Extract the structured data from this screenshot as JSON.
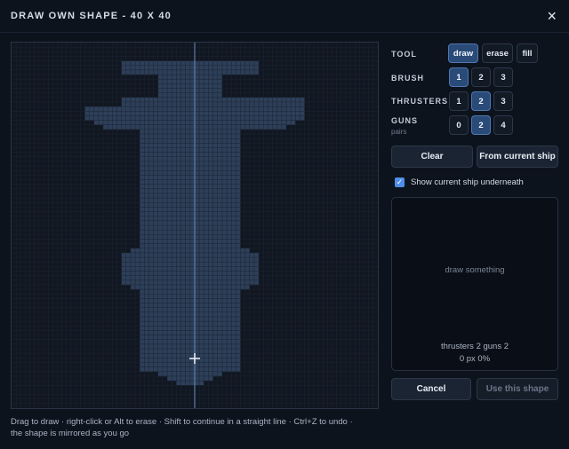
{
  "header": {
    "title": "DRAW OWN SHAPE - 40 X 40",
    "close_label": "×"
  },
  "canvas": {
    "grid_size": 40,
    "background": "#0d1119",
    "empty_cell": "#111721",
    "grid_line": "#1c2431",
    "filled_cell": "#2d3f59",
    "filled_grid_line": "#34486a",
    "axis_color": "#5d7eaa",
    "rows_filled_extents": [
      [
        0,
        0
      ],
      [
        0,
        0
      ],
      [
        0,
        0
      ],
      [
        0,
        0
      ],
      [
        12,
        27
      ],
      [
        12,
        27
      ],
      [
        12,
        27
      ],
      [
        16,
        23
      ],
      [
        16,
        23
      ],
      [
        16,
        23
      ],
      [
        16,
        23
      ],
      [
        16,
        23
      ],
      [
        12,
        32
      ],
      [
        12,
        32
      ],
      [
        8,
        32
      ],
      [
        8,
        32
      ],
      [
        8,
        32
      ],
      [
        9,
        31
      ],
      [
        10,
        30
      ],
      [
        14,
        25
      ],
      [
        14,
        25
      ],
      [
        14,
        25
      ],
      [
        14,
        25
      ],
      [
        14,
        25
      ],
      [
        14,
        25
      ],
      [
        14,
        25
      ],
      [
        14,
        25
      ],
      [
        14,
        25
      ],
      [
        14,
        25
      ],
      [
        14,
        25
      ],
      [
        14,
        25
      ],
      [
        14,
        25
      ],
      [
        14,
        25
      ],
      [
        14,
        25
      ],
      [
        14,
        25
      ],
      [
        14,
        25
      ],
      [
        14,
        25
      ],
      [
        14,
        25
      ],
      [
        14,
        25
      ],
      [
        14,
        25
      ],
      [
        14,
        25
      ],
      [
        14,
        25
      ],
      [
        14,
        25
      ],
      [
        14,
        25
      ],
      [
        14,
        25
      ],
      [
        13,
        26
      ],
      [
        12,
        27
      ],
      [
        12,
        27
      ],
      [
        12,
        27
      ],
      [
        12,
        27
      ],
      [
        12,
        27
      ],
      [
        12,
        27
      ],
      [
        12,
        27
      ],
      [
        13,
        26
      ],
      [
        14,
        25
      ],
      [
        14,
        25
      ],
      [
        14,
        25
      ],
      [
        14,
        25
      ],
      [
        14,
        25
      ],
      [
        14,
        25
      ],
      [
        14,
        25
      ],
      [
        14,
        25
      ],
      [
        14,
        25
      ],
      [
        14,
        25
      ],
      [
        14,
        25
      ],
      [
        14,
        25
      ],
      [
        14,
        25
      ],
      [
        14,
        25
      ],
      [
        14,
        25
      ],
      [
        14,
        25
      ],
      [
        14,
        25
      ],
      [
        14,
        25
      ],
      [
        16,
        23
      ],
      [
        17,
        22
      ],
      [
        18,
        21
      ],
      [
        0,
        0
      ],
      [
        0,
        0
      ],
      [
        0,
        0
      ],
      [
        0,
        0
      ],
      [
        0,
        0
      ]
    ]
  },
  "hint": "Drag to draw · right-click or Alt to erase · Shift to continue in a straight line · Ctrl+Z to undo · the shape is mirrored as you go",
  "tool": {
    "label": "TOOL",
    "options": [
      "draw",
      "erase",
      "fill"
    ],
    "active": "draw"
  },
  "brush": {
    "label": "BRUSH",
    "options": [
      "1",
      "2",
      "3"
    ],
    "active": "1"
  },
  "thrusters": {
    "label": "THRUSTERS",
    "options": [
      "1",
      "2",
      "3"
    ],
    "active": "2"
  },
  "guns": {
    "label": "GUNS",
    "sub": "pairs",
    "options": [
      "0",
      "2",
      "4"
    ],
    "active": "2"
  },
  "actions": {
    "clear": "Clear",
    "from_current": "From current ship"
  },
  "show_underneath": {
    "label": "Show current ship underneath",
    "checked": true
  },
  "preview": {
    "message": "draw something",
    "stats_line1": "thrusters 2 guns 2",
    "stats_line2": "0 px 0%"
  },
  "footer": {
    "cancel": "Cancel",
    "use": "Use this shape"
  }
}
